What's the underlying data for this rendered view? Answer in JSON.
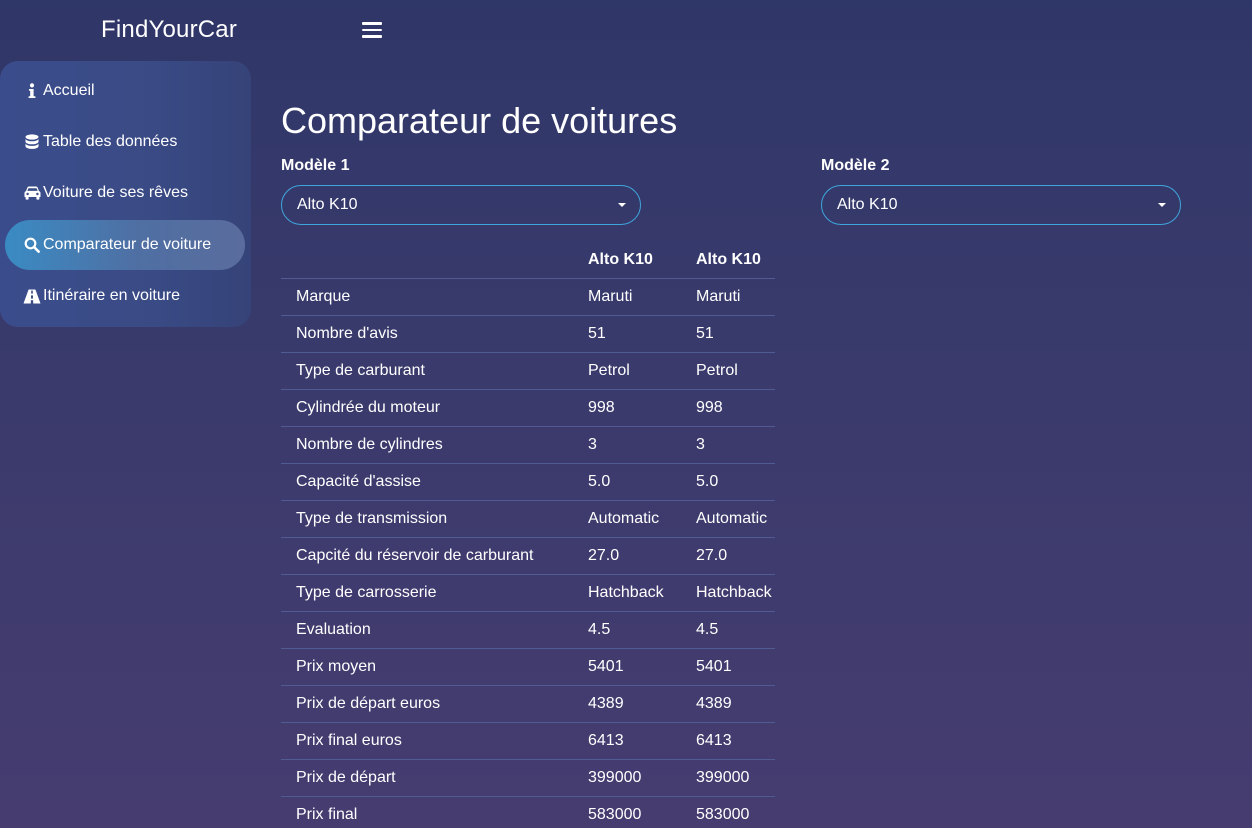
{
  "app": {
    "brand": "FindYourCar"
  },
  "sidebar": {
    "items": [
      {
        "label": "Accueil",
        "icon": "info-icon",
        "active": false
      },
      {
        "label": "Table des données",
        "icon": "database-icon",
        "active": false
      },
      {
        "label": "Voiture de ses rêves",
        "icon": "car-icon",
        "active": false
      },
      {
        "label": "Comparateur de voiture",
        "icon": "search-icon",
        "active": true
      },
      {
        "label": "Itinéraire en voiture",
        "icon": "road-icon",
        "active": false
      }
    ]
  },
  "main": {
    "title": "Comparateur de voitures",
    "model1": {
      "label": "Modèle 1",
      "value": "Alto K10"
    },
    "model2": {
      "label": "Modèle 2",
      "value": "Alto K10"
    },
    "table": {
      "headers": [
        "",
        "Alto K10",
        "Alto K10"
      ],
      "rows": [
        [
          "Marque",
          "Maruti",
          "Maruti"
        ],
        [
          "Nombre d'avis",
          "51",
          "51"
        ],
        [
          "Type de carburant",
          "Petrol",
          "Petrol"
        ],
        [
          "Cylindrée du moteur",
          "998",
          "998"
        ],
        [
          "Nombre de cylindres",
          "3",
          "3"
        ],
        [
          "Capacité d'assise",
          "5.0",
          "5.0"
        ],
        [
          "Type de transmission",
          "Automatic",
          "Automatic"
        ],
        [
          "Capcité du réservoir de carburant",
          "27.0",
          "27.0"
        ],
        [
          "Type de carrosserie",
          "Hatchback",
          "Hatchback"
        ],
        [
          "Evaluation",
          "4.5",
          "4.5"
        ],
        [
          "Prix moyen",
          "5401",
          "5401"
        ],
        [
          "Prix de départ euros",
          "4389",
          "4389"
        ],
        [
          "Prix final euros",
          "6413",
          "6413"
        ],
        [
          "Prix de départ",
          "399000",
          "399000"
        ],
        [
          "Prix final",
          "583000",
          "583000"
        ]
      ]
    }
  },
  "colors": {
    "select_border": "#3fa6dc",
    "active_nav": "#3a8bc3"
  }
}
